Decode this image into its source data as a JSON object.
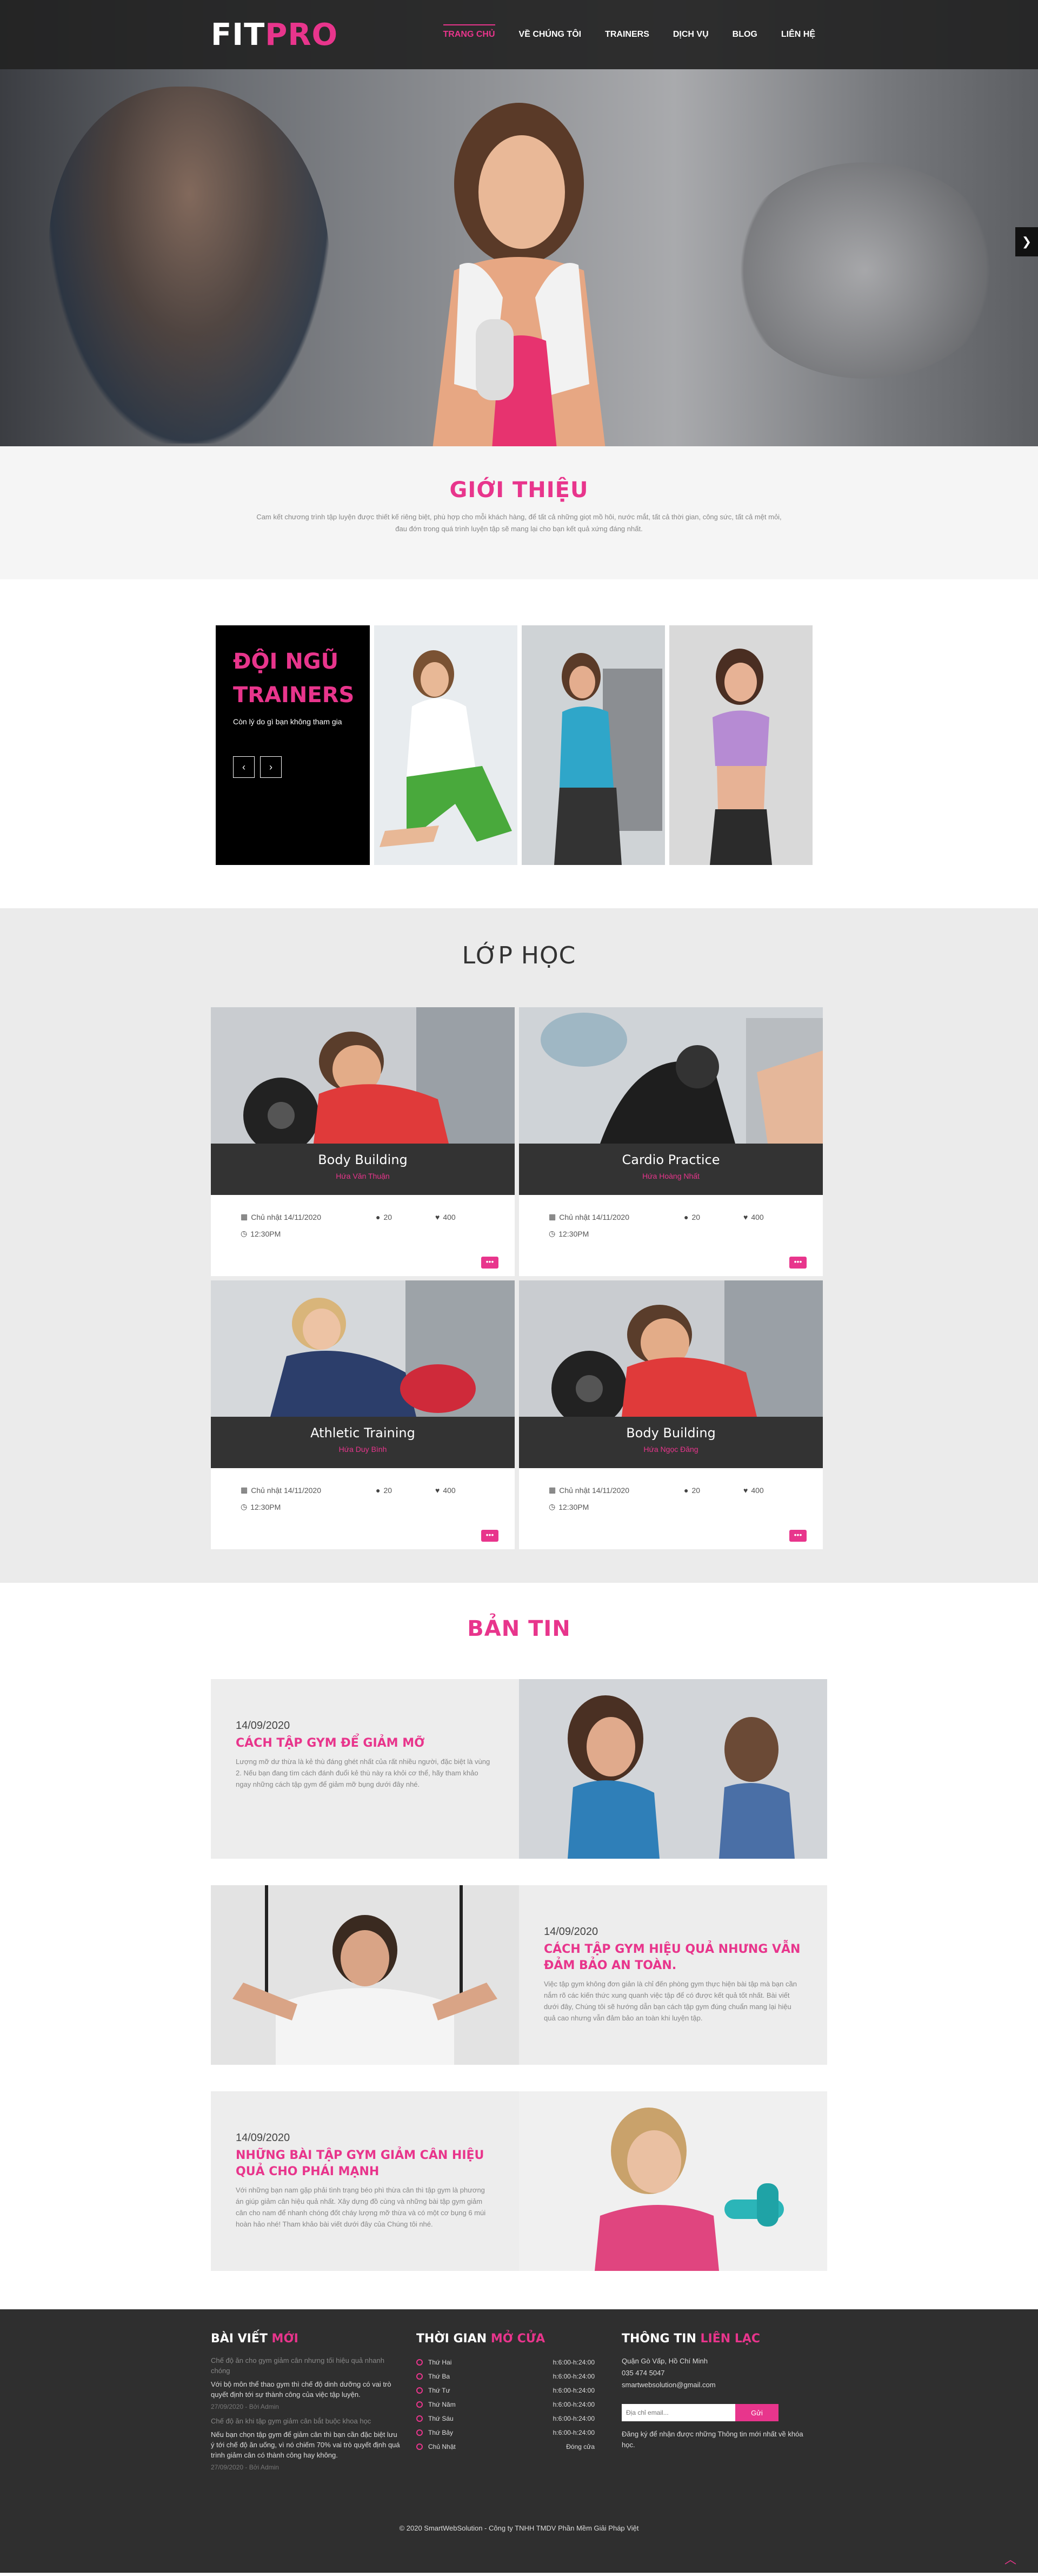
{
  "header": {
    "logo_white": "FIT",
    "logo_pink": "PRO",
    "nav": [
      "TRANG CHỦ",
      "VỀ CHÚNG TÔI",
      "TRAINERS",
      "DỊCH VỤ",
      "BLOG",
      "LIÊN HỆ"
    ]
  },
  "hero": {
    "next_icon": "chevron-right-icon"
  },
  "intro": {
    "title": "GIỚI THIỆU",
    "line1": "Cam kết chương trình tập luyện được thiết kế riêng biệt, phù hợp cho mỗi khách hàng, để tất cả những giọt mồ hôi, nước mắt, tất cả thời gian, công sức, tất cả mệt mỏi,",
    "line2": "đau đớn trong quá trình luyện tập sẽ mang lại cho bạn kết quả xứng đáng nhất."
  },
  "team": {
    "title_line1": "ĐỘI NGŨ",
    "title_line2": "TRAINERS",
    "subtitle": "Còn lý do gì bạn không tham gia",
    "prev": "‹",
    "next": "›"
  },
  "classes": {
    "title": "LỚP HỌC",
    "items": [
      {
        "name": "Body Building",
        "coach": "Hứa Văn Thuận",
        "date": "Chủ nhật 14/11/2020",
        "comments": "20",
        "likes": "400",
        "time": "12:30PM",
        "more": "•••"
      },
      {
        "name": "Cardio Practice",
        "coach": "Hứa Hoàng Nhất",
        "date": "Chủ nhật 14/11/2020",
        "comments": "20",
        "likes": "400",
        "time": "12:30PM",
        "more": "•••"
      },
      {
        "name": "Athletic Training",
        "coach": "Hứa Duy Bình",
        "date": "Chủ nhật 14/11/2020",
        "comments": "20",
        "likes": "400",
        "time": "12:30PM",
        "more": "•••"
      },
      {
        "name": "Body Building",
        "coach": "Hứa Ngọc Đăng",
        "date": "Chủ nhật 14/11/2020",
        "comments": "20",
        "likes": "400",
        "time": "12:30PM",
        "more": "•••"
      }
    ]
  },
  "news": {
    "title": "BẢN TIN",
    "items": [
      {
        "date": "14/09/2020",
        "title": "CÁCH TẬP GYM ĐỂ GIẢM MỠ",
        "excerpt": "Lượng mỡ dư thừa là kẻ thù đáng ghét nhất của rất nhiều người, đặc biệt là vùng 2. Nếu bạn đang tìm cách đánh đuổi kẻ thù này ra khỏi cơ thể, hãy tham khảo ngay những cách tập gym để giảm mỡ bụng dưới đây nhé."
      },
      {
        "date": "14/09/2020",
        "title": "CÁCH TẬP GYM HIỆU QUẢ NHƯNG VẪN ĐẢM BẢO AN TOÀN.",
        "excerpt": "Việc tập gym không đơn giản là chỉ đến phòng gym thực hiện bài tập mà bạn cần nắm rõ các kiến thức xung quanh việc tập để có được kết quả tốt nhất. Bài viết dưới đây, Chúng tôi sẽ hướng dẫn bạn cách tập gym đúng chuẩn mang lại hiệu quả cao nhưng vẫn đảm bảo an toàn khi luyện tập."
      },
      {
        "date": "14/09/2020",
        "title": "NHỮNG BÀI TẬP GYM GIẢM CÂN HIỆU QUẢ CHO PHÁI MẠNH",
        "excerpt": "Với những bạn nam gặp phải tình trạng béo phì thừa cân thì tập gym là phương án giúp giảm cân hiệu quả nhất. Xây dựng đồ cùng và những bài tập gym giảm cân cho nam để nhanh chóng đốt cháy lượng mỡ thừa và có một cơ bụng 6 múi hoàn hảo nhé! Tham khảo bài viết dưới đây của Chúng tôi nhé."
      }
    ]
  },
  "footer": {
    "posts_title_white": "BÀI VIẾT ",
    "posts_title_pink": "MỚI",
    "posts": [
      {
        "title": "Chế độ ăn cho gym giảm cân nhưng tối hiệu quả nhanh chóng",
        "desc": "Với bộ môn thể thao gym thì chế độ dinh dưỡng có vai trò quyết định tới sự thành công của việc tập luyện.",
        "meta": "27/09/2020 - Bởi Admin"
      },
      {
        "title": "Chế độ ăn khi tập gym giảm cân bắt buộc khoa học",
        "desc": "Nếu bạn chọn tập gym để giảm cân thì bạn cần đặc biệt lưu ý tới chế độ ăn uống, vì nó chiếm 70% vai trò quyết định quá trình giảm cân có thành công hay không.",
        "meta": "27/09/2020 - Bởi Admin"
      }
    ],
    "hours_title_white": "THỜI GIAN ",
    "hours_title_pink": "MỞ CỬA",
    "hours": [
      {
        "day": "Thứ Hai",
        "time": "h:6:00-h:24:00"
      },
      {
        "day": "Thứ Ba",
        "time": "h:6:00-h:24:00"
      },
      {
        "day": "Thứ Tư",
        "time": "h:6:00-h:24:00"
      },
      {
        "day": "Thứ Năm",
        "time": "h:6:00-h:24:00"
      },
      {
        "day": "Thứ Sáu",
        "time": "h:6:00-h:24:00"
      },
      {
        "day": "Thứ Bảy",
        "time": "h:6:00-h:24:00"
      },
      {
        "day": "Chủ Nhật",
        "time": "Đóng cửa"
      }
    ],
    "contact_title_white": "THÔNG TIN ",
    "contact_title_pink": "LIÊN LẠC",
    "address": "Quận Gò Vấp, Hồ Chí Minh",
    "phone": "035 474 5047",
    "email": "smartwebsolution@gmail.com",
    "email_placeholder": "Địa chỉ email...",
    "submit": "Gửi",
    "note": "Đăng ký để nhận được những Thông tin mới nhất về khóa học.",
    "copyright": "© 2020 SmartWebSolution - Công ty TNHH TMDV Phần Mềm Giải Pháp Việt",
    "back_to_top_icon": "chevron-up-icon"
  },
  "colors": {
    "accent": "#e8358c",
    "dark": "#333333",
    "footer": "#2f2f2f"
  }
}
